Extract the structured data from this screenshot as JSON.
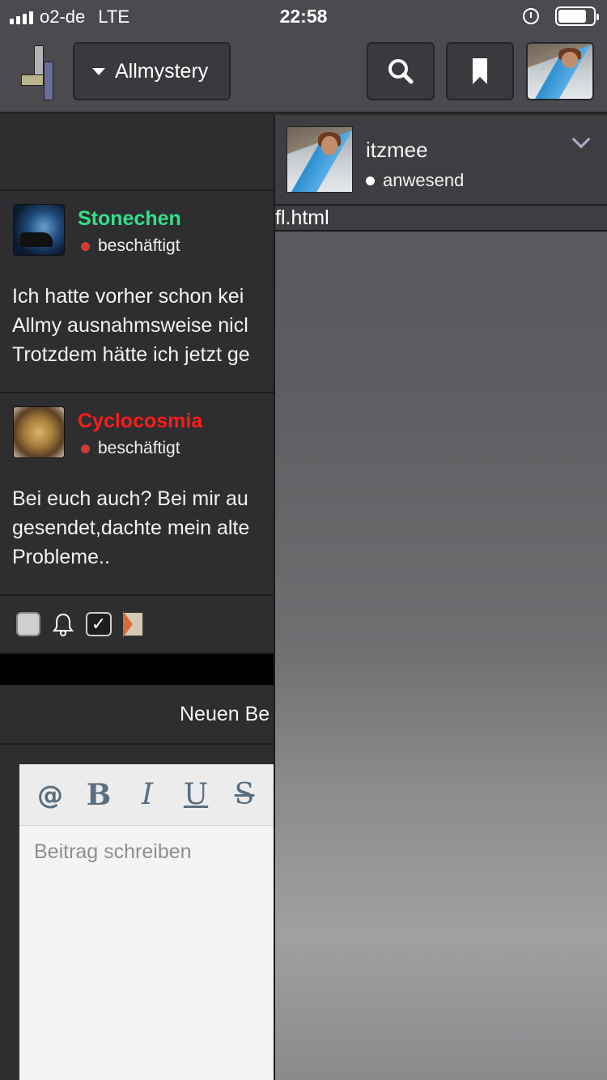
{
  "status_bar": {
    "carrier": "o2-de",
    "network": "LTE",
    "time": "22:58",
    "icons": [
      "signal-icon",
      "alarm-icon",
      "battery-icon"
    ]
  },
  "header": {
    "forum_selector": "Allmystery",
    "buttons": [
      "search-icon",
      "bookmark-icon",
      "avatar"
    ]
  },
  "posts": [
    {
      "author": "Stonechen",
      "author_color": "#33e08a",
      "status": "beschäftigt",
      "lines": [
        "Ich hatte vorher schon kei",
        "Allmy ausnahmsweise nicl",
        "Trotzdem hätte ich jetzt ge"
      ]
    },
    {
      "author": "Cyclocosmia",
      "author_color": "#ff1a1a",
      "status": "beschäftigt",
      "lines": [
        "Bei euch auch? Bei mir au",
        "gesendet,dachte mein alte",
        "Probleme.."
      ]
    }
  ],
  "new_post": {
    "label": "Neuen Be",
    "toolbar": [
      "@",
      "B",
      "I",
      "U",
      "S"
    ],
    "placeholder": "Beitrag schreiben"
  },
  "user_panel": {
    "username": "itzmee",
    "status": "anwesend",
    "url_text": "fl.html"
  },
  "colors": {
    "header_bg": "#4a4a4f",
    "content_bg": "#2e2e30",
    "status_busy": "#d23a3a"
  }
}
